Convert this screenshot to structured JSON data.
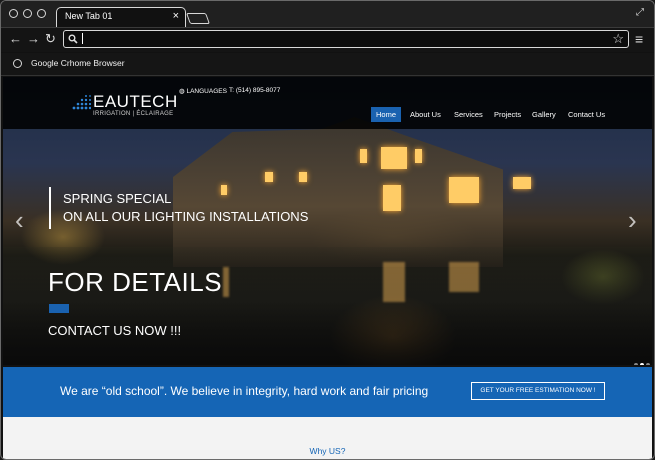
{
  "browser": {
    "tab_title": "New Tab 01",
    "tab_close": "×",
    "bookmark_label": "Google Crhome Browser",
    "nav_back": "←",
    "nav_forward": "→",
    "nav_reload": "↻",
    "star": "☆",
    "menu": "≡",
    "expand": "⤢"
  },
  "site": {
    "logo_name": "EAUTECH",
    "logo_sub": "IRRIGATION | ÉCLAIRAGE",
    "languages": "LANGUAGES",
    "phone": "T: (514) 895-8077",
    "nav": [
      "Home",
      "About Us",
      "Services",
      "Projects",
      "Gallery",
      "Contact Us"
    ],
    "active_nav": "Home",
    "hero": {
      "promo_line1": "SPRING SPECIAL",
      "promo_line2": "ON ALL OUR LIGHTING INSTALLATIONS",
      "headline": "FOR DETAILS",
      "subline": "CONTACT US NOW !!!",
      "prev": "‹",
      "next": "›",
      "slide_count": 3,
      "active_slide": 2
    },
    "band": {
      "text": "We are “old school”. We believe in integrity, hard work and fair pricing",
      "button": "GET YOUR FREE ESTIMATION NOW !"
    },
    "section_title": "Why US?"
  },
  "colors": {
    "brand_blue": "#1565b5",
    "accent_blue": "#1a62b0"
  }
}
